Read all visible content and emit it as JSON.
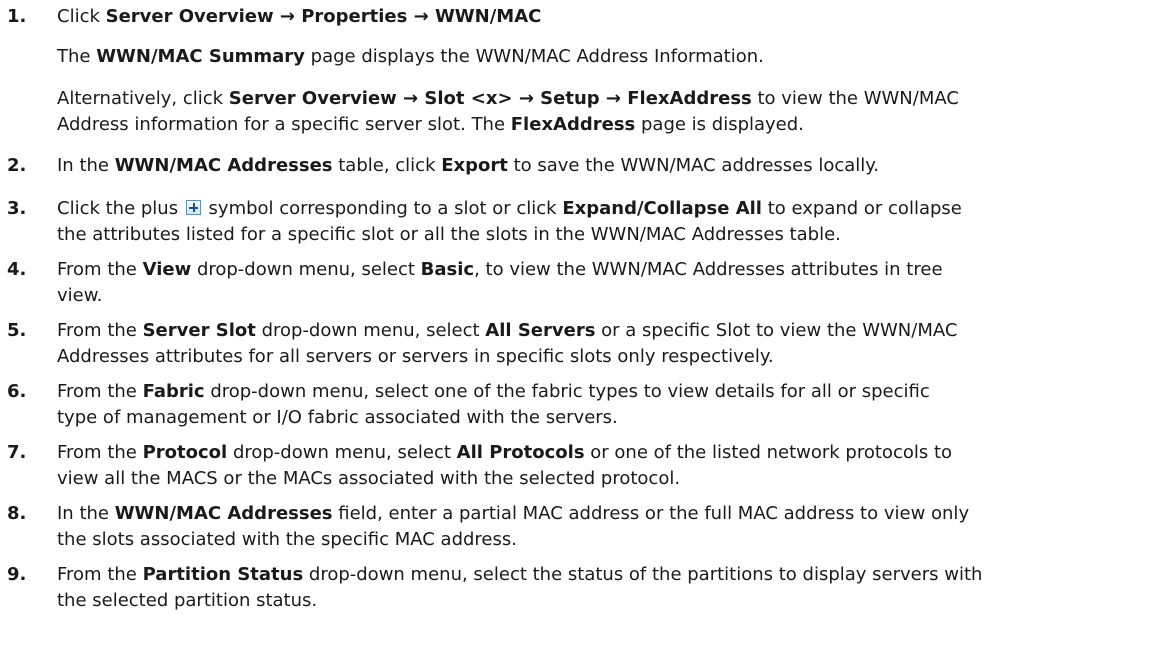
{
  "steps": [
    {
      "number": "1.",
      "paragraphs": [
        [
          {
            "t": "Click "
          },
          {
            "t": "Server Overview → Properties → WWN/MAC",
            "b": true
          }
        ],
        [
          {
            "t": "The "
          },
          {
            "t": "WWN/MAC Summary",
            "b": true
          },
          {
            "t": " page displays the WWN/MAC Address Information."
          }
        ],
        [
          {
            "t": "Alternatively, click "
          },
          {
            "t": "Server Overview → Slot <x> → Setup → FlexAddress",
            "b": true
          },
          {
            "t": " to view the WWN/MAC"
          },
          {
            "br": true
          },
          {
            "t": "Address information for a specific server slot. The "
          },
          {
            "t": "FlexAddress",
            "b": true
          },
          {
            "t": " page is displayed."
          }
        ]
      ]
    },
    {
      "number": "2.",
      "paragraphs": [
        [
          {
            "t": "In the "
          },
          {
            "t": "WWN/MAC Addresses",
            "b": true
          },
          {
            "t": " table, click "
          },
          {
            "t": "Export",
            "b": true
          },
          {
            "t": " to save the WWN/MAC addresses locally."
          }
        ]
      ]
    },
    {
      "number": "3.",
      "paragraphs": [
        [
          {
            "t": "Click the plus "
          },
          {
            "icon": "plus-icon"
          },
          {
            "t": " symbol corresponding to a slot or click "
          },
          {
            "t": "Expand/Collapse All",
            "b": true
          },
          {
            "t": " to expand or collapse"
          },
          {
            "br": true
          },
          {
            "t": "the attributes listed for a specific slot or all the slots in the WWN/MAC Addresses table."
          }
        ]
      ]
    },
    {
      "number": "4.",
      "paragraphs": [
        [
          {
            "t": "From the "
          },
          {
            "t": "View",
            "b": true
          },
          {
            "t": " drop-down menu, select "
          },
          {
            "t": "Basic",
            "b": true
          },
          {
            "t": ", to view the WWN/MAC Addresses attributes in tree"
          },
          {
            "br": true
          },
          {
            "t": "view."
          }
        ]
      ]
    },
    {
      "number": "5.",
      "paragraphs": [
        [
          {
            "t": "From the "
          },
          {
            "t": "Server Slot",
            "b": true
          },
          {
            "t": " drop-down menu, select "
          },
          {
            "t": "All Servers",
            "b": true
          },
          {
            "t": " or a specific Slot to view the WWN/MAC"
          },
          {
            "br": true
          },
          {
            "t": "Addresses attributes for all servers or servers in specific slots only respectively."
          }
        ]
      ]
    },
    {
      "number": "6.",
      "paragraphs": [
        [
          {
            "t": "From the "
          },
          {
            "t": "Fabric",
            "b": true
          },
          {
            "t": " drop-down menu, select one of the fabric types to view details for all or specific"
          },
          {
            "br": true
          },
          {
            "t": "type of management or I/O fabric associated with the servers."
          }
        ]
      ]
    },
    {
      "number": "7.",
      "paragraphs": [
        [
          {
            "t": "From the "
          },
          {
            "t": "Protocol",
            "b": true
          },
          {
            "t": " drop-down menu, select "
          },
          {
            "t": "All Protocols",
            "b": true
          },
          {
            "t": " or one of the listed network protocols to"
          },
          {
            "br": true
          },
          {
            "t": "view all the MACS or the MACs associated with the selected protocol."
          }
        ]
      ]
    },
    {
      "number": "8.",
      "paragraphs": [
        [
          {
            "t": "In the "
          },
          {
            "t": "WWN/MAC Addresses",
            "b": true
          },
          {
            "t": " field, enter a partial MAC address or the full MAC address to view only"
          },
          {
            "br": true
          },
          {
            "t": "the slots associated with the specific MAC address."
          }
        ]
      ]
    },
    {
      "number": "9.",
      "paragraphs": [
        [
          {
            "t": "From the "
          },
          {
            "t": "Partition Status",
            "b": true
          },
          {
            "t": " drop-down menu, select the status of the partitions to display servers with"
          },
          {
            "br": true
          },
          {
            "t": "the selected partition status."
          }
        ]
      ]
    }
  ]
}
